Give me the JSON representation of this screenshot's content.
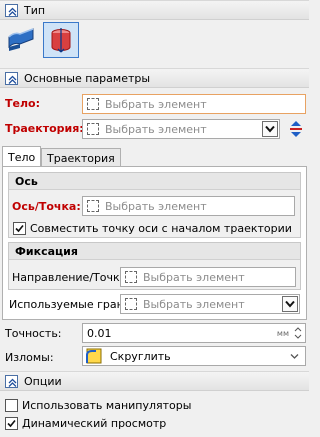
{
  "sections": {
    "type": {
      "title": "Тип"
    },
    "main_params": {
      "title": "Основные параметры"
    },
    "options": {
      "title": "Опции"
    }
  },
  "type_buttons": [
    {
      "icon": "sweep-surface-icon",
      "selected": false
    },
    {
      "icon": "sweep-solid-icon",
      "selected": true
    }
  ],
  "fields": {
    "body": {
      "label": "Тело:",
      "placeholder": "Выбрать элемент"
    },
    "trajectory": {
      "label": "Траектория:",
      "placeholder": "Выбрать элемент"
    }
  },
  "tabs": [
    {
      "label": "Тело",
      "active": true
    },
    {
      "label": "Траектория",
      "active": false
    }
  ],
  "axis_group": {
    "title": "Ось",
    "axis_point_label": "Ось/Точка:",
    "axis_point_placeholder": "Выбрать элемент",
    "align_checkbox_label": "Совместить точку оси с началом траектории",
    "align_checked": true
  },
  "fix_group": {
    "title": "Фиксация",
    "direction_label": "Направление/Точка:",
    "direction_placeholder": "Выбрать элемент"
  },
  "used_faces": {
    "label": "Используемые грани:",
    "placeholder": "Выбрать элемент"
  },
  "precision": {
    "label": "Точность:",
    "value": "0.01",
    "unit": "мм"
  },
  "breaks": {
    "label": "Изломы:",
    "value": "Скруглить"
  },
  "options": {
    "use_manipulators": {
      "label": "Использовать манипуляторы",
      "checked": false
    },
    "dynamic_preview": {
      "label": "Динамический просмотр",
      "checked": true
    }
  },
  "colors": {
    "required": "#c00000",
    "accent": "#3a78c9",
    "active_border": "#e8a262"
  }
}
